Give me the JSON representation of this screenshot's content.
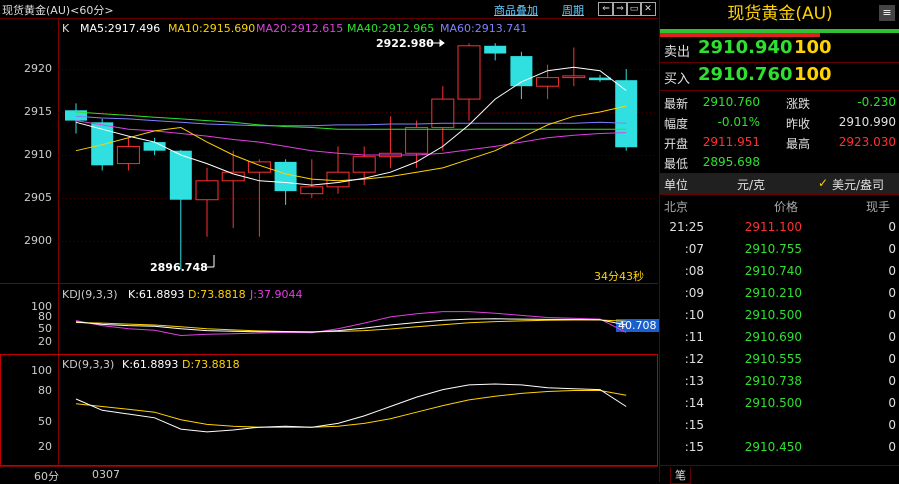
{
  "topbar": {
    "title": "现货黄金(AU)<60分>",
    "overlay_label": "商品叠加",
    "period_label": "周期",
    "buttons": [
      "⇐",
      "⇒",
      "▭",
      "✕"
    ]
  },
  "main_legend": {
    "type_label": "K",
    "ma5": "MA5:2917.496",
    "ma10": "MA10:2915.690",
    "ma20": "MA20:2912.615",
    "ma40": "MA40:2912.965",
    "ma60": "MA60:2913.741"
  },
  "main_axis": {
    "ticks": [
      "2920",
      "2915",
      "2910",
      "2905",
      "2900"
    ]
  },
  "annotations": {
    "high": "2922.980",
    "low": "2896.748",
    "countdown": "34分43秒"
  },
  "kdj": {
    "legend_name": "KDJ(9,3,3)",
    "k": "K:61.8893",
    "d": "D:73.8818",
    "j": "J:37.9044",
    "ticks": [
      "100",
      "80",
      "50",
      "20"
    ],
    "current_value": "40.708"
  },
  "kd": {
    "legend_name": "KD(9,3,3)",
    "k": "K:61.8893",
    "d": "D:73.8818",
    "ticks": [
      "100",
      "80",
      "50",
      "20"
    ]
  },
  "bottom": {
    "period": "60分",
    "date": "0307"
  },
  "colors": {
    "up": "#ff3030",
    "down": "#30e0e0",
    "ma5": "#ffffff",
    "ma10": "#ffd200",
    "ma20": "#e040e0",
    "ma40": "#30e030",
    "ma60": "#8080ff",
    "kdj_j": "#e040e0"
  },
  "chart_data": {
    "type": "candlestick",
    "ylim": [
      2894,
      2925
    ],
    "candles": [
      {
        "o": 2915.2,
        "h": 2916.0,
        "l": 2912.5,
        "c": 2914.0
      },
      {
        "o": 2913.8,
        "h": 2914.2,
        "l": 2908.2,
        "c": 2908.8
      },
      {
        "o": 2909.0,
        "h": 2912.0,
        "l": 2908.2,
        "c": 2911.0
      },
      {
        "o": 2911.5,
        "h": 2912.0,
        "l": 2910.0,
        "c": 2910.5
      },
      {
        "o": 2910.5,
        "h": 2910.6,
        "l": 2896.7,
        "c": 2904.8
      },
      {
        "o": 2904.8,
        "h": 2908.5,
        "l": 2900.5,
        "c": 2907.0
      },
      {
        "o": 2907.0,
        "h": 2910.5,
        "l": 2901.5,
        "c": 2908.0
      },
      {
        "o": 2908.0,
        "h": 2909.5,
        "l": 2900.5,
        "c": 2909.2
      },
      {
        "o": 2909.2,
        "h": 2909.5,
        "l": 2904.2,
        "c": 2905.8
      },
      {
        "o": 2905.5,
        "h": 2909.5,
        "l": 2905.0,
        "c": 2906.3
      },
      {
        "o": 2906.3,
        "h": 2911.0,
        "l": 2905.5,
        "c": 2908.0
      },
      {
        "o": 2908.0,
        "h": 2911.0,
        "l": 2906.5,
        "c": 2909.8
      },
      {
        "o": 2909.8,
        "h": 2914.5,
        "l": 2908.5,
        "c": 2910.2
      },
      {
        "o": 2910.2,
        "h": 2914.0,
        "l": 2908.5,
        "c": 2913.2
      },
      {
        "o": 2913.2,
        "h": 2918.0,
        "l": 2910.5,
        "c": 2916.5
      },
      {
        "o": 2916.5,
        "h": 2923.0,
        "l": 2914.0,
        "c": 2922.7
      },
      {
        "o": 2922.7,
        "h": 2923.0,
        "l": 2921.0,
        "c": 2921.8
      },
      {
        "o": 2921.5,
        "h": 2922.0,
        "l": 2916.5,
        "c": 2918.0
      },
      {
        "o": 2918.0,
        "h": 2920.5,
        "l": 2916.5,
        "c": 2919.0
      },
      {
        "o": 2919.0,
        "h": 2922.5,
        "l": 2918.0,
        "c": 2919.2
      },
      {
        "o": 2919.0,
        "h": 2919.3,
        "l": 2918.5,
        "c": 2918.7
      },
      {
        "o": 2918.7,
        "h": 2920.0,
        "l": 2910.5,
        "c": 2910.9
      }
    ],
    "ma5": [
      2913.8,
      2913.0,
      2912.2,
      2911.5,
      2910.0,
      2909.0,
      2907.8,
      2907.0,
      2906.8,
      2906.5,
      2906.8,
      2907.3,
      2908.0,
      2909.2,
      2911.0,
      2913.5,
      2916.5,
      2918.5,
      2919.8,
      2920.2,
      2919.8,
      2917.5
    ],
    "ma10": [
      2910.5,
      2911.2,
      2912.0,
      2912.8,
      2913.2,
      2911.5,
      2910.0,
      2908.8,
      2907.8,
      2907.2,
      2907.0,
      2907.2,
      2907.5,
      2908.0,
      2908.5,
      2909.5,
      2910.5,
      2912.0,
      2913.5,
      2914.5,
      2915.0,
      2915.7
    ],
    "ma20": [
      2914.0,
      2913.5,
      2913.0,
      2912.8,
      2912.5,
      2912.2,
      2911.8,
      2911.5,
      2911.0,
      2910.5,
      2910.2,
      2910.0,
      2910.0,
      2910.0,
      2910.2,
      2910.6,
      2911.0,
      2911.5,
      2912.0,
      2912.3,
      2912.5,
      2912.6
    ],
    "ma40": [
      2915.0,
      2914.8,
      2914.6,
      2914.4,
      2914.2,
      2914.0,
      2913.8,
      2913.5,
      2913.3,
      2913.2,
      2913.0,
      2913.0,
      2913.0,
      2913.0,
      2913.0,
      2913.0,
      2913.0,
      2913.0,
      2913.0,
      2913.0,
      2913.0,
      2913.0
    ],
    "ma60": [
      2914.5,
      2914.3,
      2914.2,
      2914.0,
      2913.8,
      2913.6,
      2913.5,
      2913.4,
      2913.4,
      2913.4,
      2913.5,
      2913.5,
      2913.6,
      2913.6,
      2913.7,
      2913.7,
      2913.7,
      2913.7,
      2913.7,
      2913.7,
      2913.8,
      2913.7
    ],
    "kdj_k": [
      72,
      64,
      60,
      58,
      50,
      44,
      42,
      40,
      40,
      39,
      44,
      52,
      62,
      70,
      77,
      81,
      82,
      81,
      80,
      80,
      79,
      62
    ],
    "kdj_d": [
      70,
      68,
      65,
      62,
      56,
      50,
      46,
      43,
      41,
      40,
      41,
      44,
      49,
      56,
      63,
      69,
      73,
      75,
      77,
      78,
      78,
      74
    ],
    "kdj_j": [
      76,
      60,
      50,
      45,
      28,
      32,
      34,
      36,
      38,
      37,
      50,
      68,
      88,
      98,
      105,
      105,
      100,
      93,
      86,
      84,
      81,
      38
    ],
    "kd_k": [
      70,
      58,
      54,
      50,
      38,
      35,
      37,
      40,
      41,
      40,
      44,
      52,
      62,
      72,
      80,
      85,
      86,
      85,
      82,
      81,
      80,
      62
    ],
    "kd_d": [
      65,
      62,
      59,
      56,
      48,
      43,
      41,
      40,
      40,
      40,
      41,
      44,
      49,
      56,
      63,
      69,
      73,
      76,
      78,
      79,
      79,
      74
    ]
  },
  "quote": {
    "title": "现货黄金(AU)",
    "sell_label": "卖出",
    "sell_price": "2910.940",
    "sell_qty": "100",
    "buy_label": "买入",
    "buy_price": "2910.760",
    "buy_qty": "100",
    "rows": [
      {
        "l1": "最新",
        "v1": "2910.760",
        "c1": "dn",
        "l2": "涨跌",
        "v2": "-0.230",
        "c2": "dn"
      },
      {
        "l1": "幅度",
        "v1": "-0.01%",
        "c1": "dn",
        "l2": "昨收",
        "v2": "2910.990",
        "c2": "wh"
      },
      {
        "l1": "开盘",
        "v1": "2911.951",
        "c1": "up",
        "l2": "最高",
        "v2": "2923.030",
        "c2": "up"
      },
      {
        "l1": "最低",
        "v1": "2895.698",
        "c1": "dn",
        "l2": "",
        "v2": "",
        "c2": "wh"
      }
    ],
    "unit_label": "单位",
    "unit_value": "元/克",
    "unit_option": "美元/盎司",
    "tick_headers": {
      "time": "北京",
      "price": "价格",
      "qty": "现手"
    },
    "ticks": [
      {
        "t": "21:25",
        "p": "2911.100",
        "c": "up",
        "q": "0"
      },
      {
        "t": ":07",
        "p": "2910.755",
        "c": "dn",
        "q": "0"
      },
      {
        "t": ":08",
        "p": "2910.740",
        "c": "dn",
        "q": "0"
      },
      {
        "t": ":09",
        "p": "2910.210",
        "c": "dn",
        "q": "0"
      },
      {
        "t": ":10",
        "p": "2910.500",
        "c": "dn",
        "q": "0"
      },
      {
        "t": ":11",
        "p": "2910.690",
        "c": "dn",
        "q": "0"
      },
      {
        "t": ":12",
        "p": "2910.555",
        "c": "dn",
        "q": "0"
      },
      {
        "t": ":13",
        "p": "2910.738",
        "c": "dn",
        "q": "0"
      },
      {
        "t": ":14",
        "p": "2910.500",
        "c": "dn",
        "q": "0"
      },
      {
        "t": ":15",
        "p": "",
        "c": "dn",
        "q": "0"
      },
      {
        "t": ":15",
        "p": "2910.450",
        "c": "dn",
        "q": "0"
      }
    ],
    "bottom_tab": "笔"
  }
}
